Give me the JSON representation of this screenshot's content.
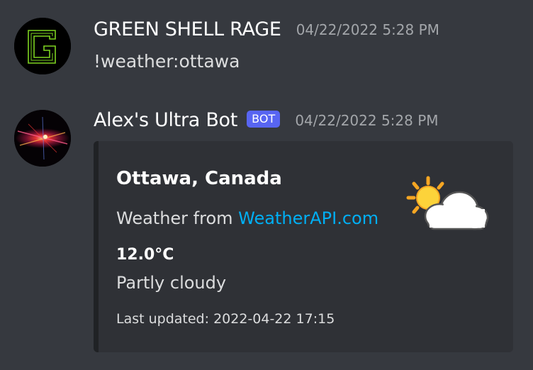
{
  "messages": [
    {
      "author": "GREEN SHELL RAGE",
      "timestamp": "04/22/2022 5:28 PM",
      "content": "!weather:ottawa"
    },
    {
      "author": "Alex's Ultra Bot",
      "badge": "BOT",
      "timestamp": "04/22/2022 5:28 PM",
      "embed": {
        "title": "Ottawa, Canada",
        "description_prefix": "Weather from ",
        "link_text": "WeatherAPI.com",
        "temperature": "12.0°C",
        "condition": "Partly cloudy",
        "footer": "Last updated: 2022-04-22 17:15",
        "thumbnail_icon": "partly-cloudy-icon"
      }
    }
  ],
  "colors": {
    "background": "#36393f",
    "embed_background": "#2f3136",
    "bot_badge": "#5865f2",
    "link": "#00aff4",
    "timestamp": "#a3a6aa"
  }
}
